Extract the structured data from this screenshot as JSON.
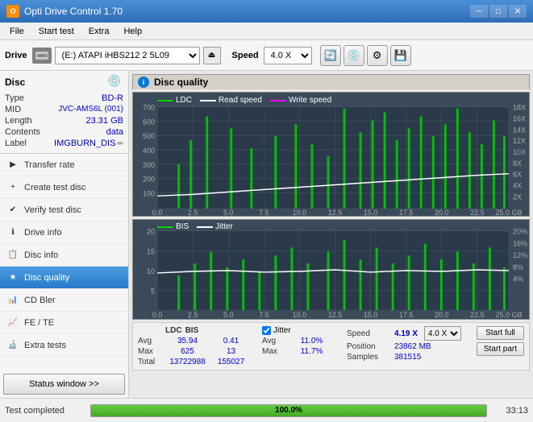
{
  "titleBar": {
    "title": "Opti Drive Control 1.70",
    "minBtn": "─",
    "maxBtn": "□",
    "closeBtn": "✕"
  },
  "menuBar": {
    "items": [
      "File",
      "Start test",
      "Extra",
      "Help"
    ]
  },
  "toolbar": {
    "driveLabel": "Drive",
    "driveValue": "(E:)  ATAPI iHBS212  2 5L09",
    "speedLabel": "Speed",
    "speedValue": "4.0 X",
    "ejectSymbol": "⏏"
  },
  "disc": {
    "title": "Disc",
    "typeLabel": "Type",
    "typeValue": "BD-R",
    "midLabel": "MID",
    "midValue": "JVC-AMS6L (001)",
    "lengthLabel": "Length",
    "lengthValue": "23.31 GB",
    "contentsLabel": "Contents",
    "contentsValue": "data",
    "labelLabel": "Label",
    "labelValue": "IMGBURN_DIS"
  },
  "navItems": [
    {
      "id": "transfer-rate",
      "label": "Transfer rate",
      "icon": "▶"
    },
    {
      "id": "create-test-disc",
      "label": "Create test disc",
      "icon": "💿"
    },
    {
      "id": "verify-test-disc",
      "label": "Verify test disc",
      "icon": "✔"
    },
    {
      "id": "drive-info",
      "label": "Drive info",
      "icon": "ℹ"
    },
    {
      "id": "disc-info",
      "label": "Disc info",
      "icon": "📋"
    },
    {
      "id": "disc-quality",
      "label": "Disc quality",
      "icon": "★",
      "active": true
    },
    {
      "id": "cd-bler",
      "label": "CD Bler",
      "icon": "📊"
    },
    {
      "id": "fe-te",
      "label": "FE / TE",
      "icon": "📈"
    },
    {
      "id": "extra-tests",
      "label": "Extra tests",
      "icon": "🔬"
    }
  ],
  "statusWindowBtn": "Status window >>",
  "chartTitle": "Disc quality",
  "topChart": {
    "legend": [
      {
        "label": "LDC",
        "color": "#00aa00"
      },
      {
        "label": "Read speed",
        "color": "#ffffff"
      },
      {
        "label": "Write speed",
        "color": "#ff00ff"
      }
    ],
    "yAxisLeft": [
      "700",
      "600",
      "500",
      "400",
      "300",
      "200",
      "100"
    ],
    "yAxisRight": [
      "18X",
      "16X",
      "14X",
      "12X",
      "10X",
      "8X",
      "6X",
      "4X",
      "2X"
    ],
    "xAxis": [
      "0.0",
      "2.5",
      "5.0",
      "7.5",
      "10.0",
      "12.5",
      "15.0",
      "17.5",
      "20.0",
      "22.5",
      "25.0 GB"
    ]
  },
  "bottomChart": {
    "legend": [
      {
        "label": "BIS",
        "color": "#00aa00"
      },
      {
        "label": "Jitter",
        "color": "#ffffff"
      }
    ],
    "yAxisLeft": [
      "20",
      "15",
      "10",
      "5"
    ],
    "yAxisRight": [
      "20%",
      "16%",
      "12%",
      "8%",
      "4%"
    ],
    "xAxis": [
      "0.0",
      "2.5",
      "5.0",
      "7.5",
      "10.0",
      "12.5",
      "15.0",
      "17.5",
      "20.0",
      "22.5",
      "25.0 GB"
    ]
  },
  "stats": {
    "ldcHeader": "LDC",
    "bisHeader": "BIS",
    "avgLabel": "Avg",
    "ldcAvg": "35.94",
    "bisAvg": "0.41",
    "maxLabel": "Max",
    "ldcMax": "625",
    "bisMax": "13",
    "totalLabel": "Total",
    "ldcTotal": "13722988",
    "bisTotal": "155027",
    "jitterLabel": "Jitter",
    "jitterAvg": "11.0%",
    "jitterMax": "11.7%",
    "speedLabel": "Speed",
    "speedValue": "4.19 X",
    "speedTarget": "4.0 X",
    "positionLabel": "Position",
    "positionValue": "23862 MB",
    "samplesLabel": "Samples",
    "samplesValue": "381515",
    "startFullBtn": "Start full",
    "startPartBtn": "Start part"
  },
  "statusBar": {
    "statusText": "Test completed",
    "progressPct": "100.0%",
    "progressWidth": "100",
    "timeText": "33:13"
  }
}
